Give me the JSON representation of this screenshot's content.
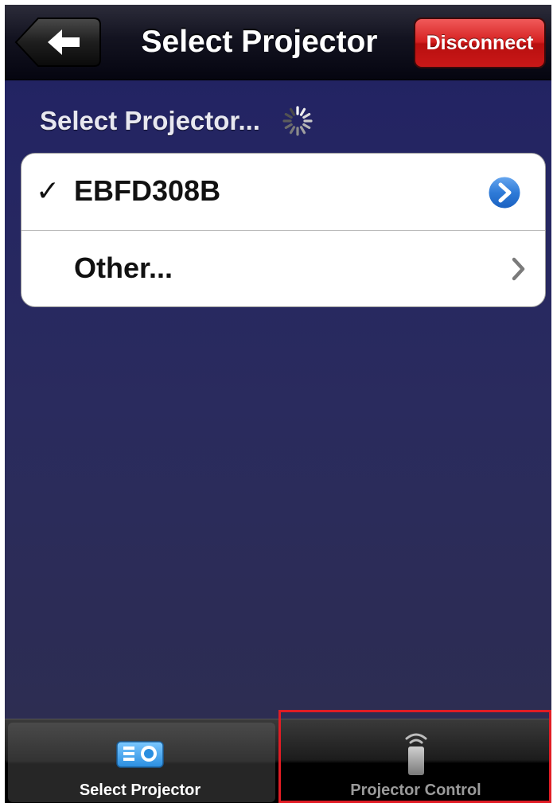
{
  "navbar": {
    "title": "Select Projector",
    "back_icon": "back-arrow-icon",
    "disconnect_label": "Disconnect"
  },
  "section": {
    "header": "Select Projector...",
    "spinner_icon": "activity-spinner-icon"
  },
  "projector_list": {
    "items": [
      {
        "label": "EBFD308B",
        "selected": true,
        "check_mark": "✓",
        "accessory": "detail-disclosure-icon"
      },
      {
        "label": "Other...",
        "selected": false,
        "accessory": "chevron-right-icon"
      }
    ]
  },
  "tabbar": {
    "tabs": [
      {
        "label": "Select Projector",
        "icon": "projector-icon",
        "active": true
      },
      {
        "label": "Projector Control",
        "icon": "remote-control-icon",
        "active": false
      }
    ]
  },
  "colors": {
    "background": "#232463",
    "disconnect": "#d52020",
    "disclosure_blue": "#2f7bd8",
    "highlight": "#e01c24"
  }
}
